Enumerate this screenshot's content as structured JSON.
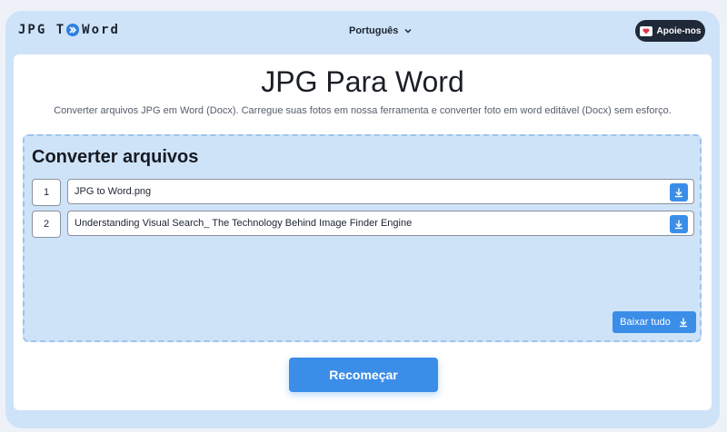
{
  "header": {
    "logo_left": "JPG T",
    "logo_right": "Word",
    "language": "Português",
    "support_label": "Apoie-nos"
  },
  "main": {
    "title": "JPG Para Word",
    "subtitle": "Converter arquivos JPG em Word (Docx). Carregue suas fotos em nossa ferramenta e converter foto em word editável (Docx) sem esforço."
  },
  "converter": {
    "title": "Converter arquivos",
    "files": [
      {
        "index": "1",
        "name": "JPG to Word.png"
      },
      {
        "index": "2",
        "name": "Understanding Visual Search_ The Technology Behind Image Finder Engine"
      }
    ],
    "download_all_label": "Baixar tudo"
  },
  "actions": {
    "restart_label": "Recomeçar"
  },
  "colors": {
    "accent": "#3b8ee8",
    "frame_bg": "#cfe3f8",
    "dark_pill": "#1f2937"
  },
  "icons": {
    "language_toggle": "chevron-down-icon",
    "support": "coffee-heart-icon",
    "file_download": "download-icon",
    "logo_badge": "double-chevron-right-icon"
  }
}
